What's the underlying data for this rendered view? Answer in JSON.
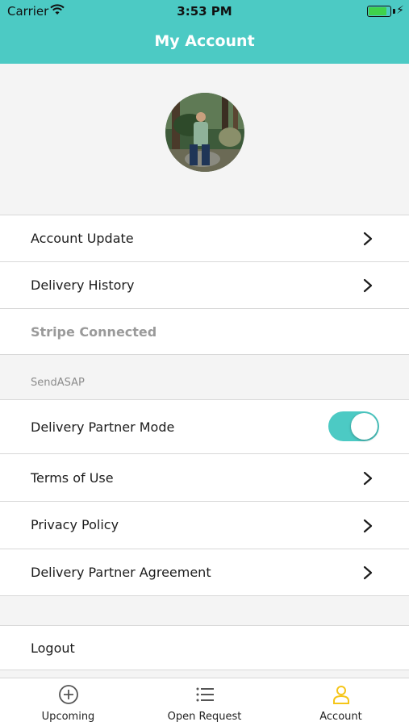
{
  "status_bar": {
    "carrier": "Carrier",
    "time": "3:53 PM"
  },
  "header": {
    "title": "My Account"
  },
  "menu": {
    "account_update": "Account Update",
    "delivery_history": "Delivery History",
    "stripe_connected": "Stripe Connected",
    "section_title": "SendASAP",
    "delivery_partner_mode": "Delivery Partner Mode",
    "delivery_partner_mode_on": true,
    "terms_of_use": "Terms of Use",
    "privacy_policy": "Privacy Policy",
    "delivery_partner_agreement": "Delivery Partner Agreement",
    "logout": "Logout"
  },
  "tabs": {
    "upcoming": "Upcoming",
    "open_request": "Open Request",
    "account": "Account",
    "active_tab": "Account"
  },
  "colors": {
    "accent": "#4ccac4",
    "active_tab": "#f5c518",
    "chevron": "#1c1c1c"
  }
}
